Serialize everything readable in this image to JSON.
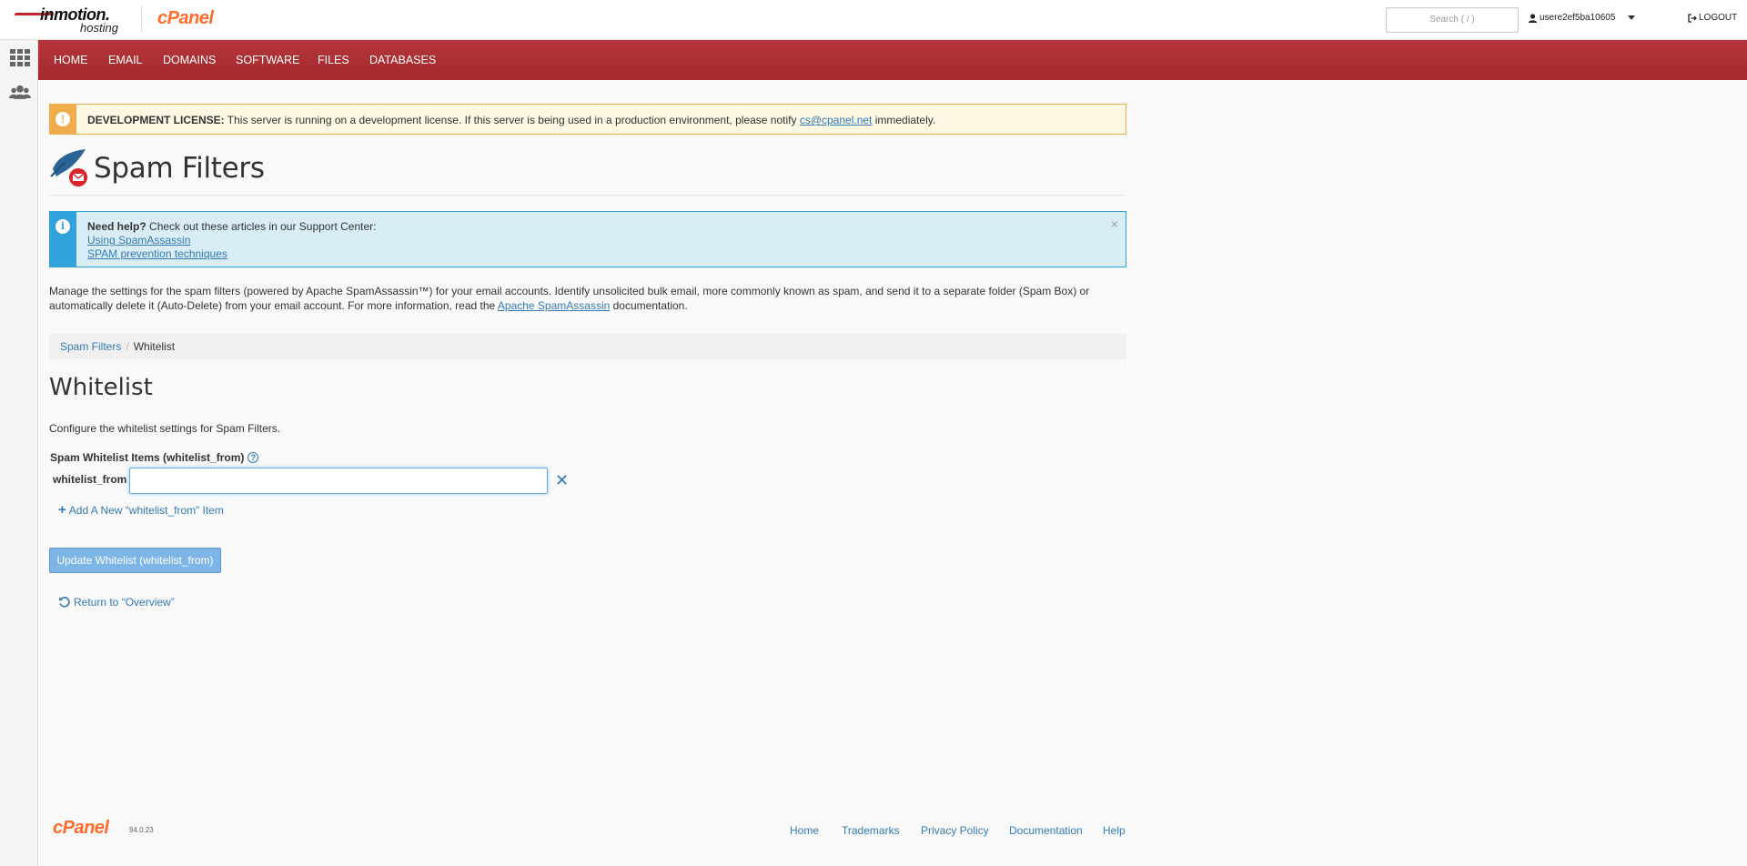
{
  "header": {
    "brand_line1": "inmotion.",
    "brand_line2": "hosting",
    "cpanel_logo": "cPanel",
    "search_placeholder": "Search ( / )",
    "username": "usere2ef5ba10605",
    "logout_label": "LOGOUT"
  },
  "nav": {
    "items": [
      {
        "label": "HOME"
      },
      {
        "label": "EMAIL"
      },
      {
        "label": "DOMAINS"
      },
      {
        "label": "SOFTWARE"
      },
      {
        "label": "FILES"
      },
      {
        "label": "DATABASES"
      }
    ],
    "color": "#a82d31"
  },
  "warning": {
    "strong": "DEVELOPMENT LICENSE:",
    "text": " This server is running on a development license. If this server is being used in a production environment, please notify ",
    "link": "cs@cpanel.net",
    "text_after": " immediately."
  },
  "page": {
    "title": "Spam Filters",
    "icon": "spam-filters-icon"
  },
  "info": {
    "strong": "Need help?",
    "text": " Check out these articles in our Support Center:",
    "link1": "Using SpamAssassin",
    "link2": "SPAM prevention techniques",
    "close": "×"
  },
  "description": {
    "part1": "Manage the settings for the spam filters (powered by Apache SpamAssassin™) for your email accounts. Identify unsolicited bulk email, more commonly known as spam, and send it to a separate folder (Spam Box) or automatically delete it (Auto-Delete) from your email account. For more information, read the ",
    "link": "Apache SpamAssassin",
    "part2": " documentation."
  },
  "breadcrumb": {
    "parent": "Spam Filters",
    "separator": "/",
    "current": "Whitelist"
  },
  "whitelist": {
    "heading": "Whitelist",
    "description": "Configure the whitelist settings for Spam Filters.",
    "field_label": "Spam Whitelist Items (whitelist_from)",
    "help": "?",
    "row_label": "whitelist_from",
    "input_value": "",
    "remove_symbol": "✕",
    "add_label": "Add A New “whitelist_from” Item",
    "update_label": "Update Whitelist (whitelist_from)",
    "return_label": "Return to “Overview”"
  },
  "footer": {
    "logo": "cPanel",
    "version": "94.0.23",
    "links": [
      "Home",
      "Trademarks",
      "Privacy Policy",
      "Documentation",
      "Help"
    ]
  }
}
